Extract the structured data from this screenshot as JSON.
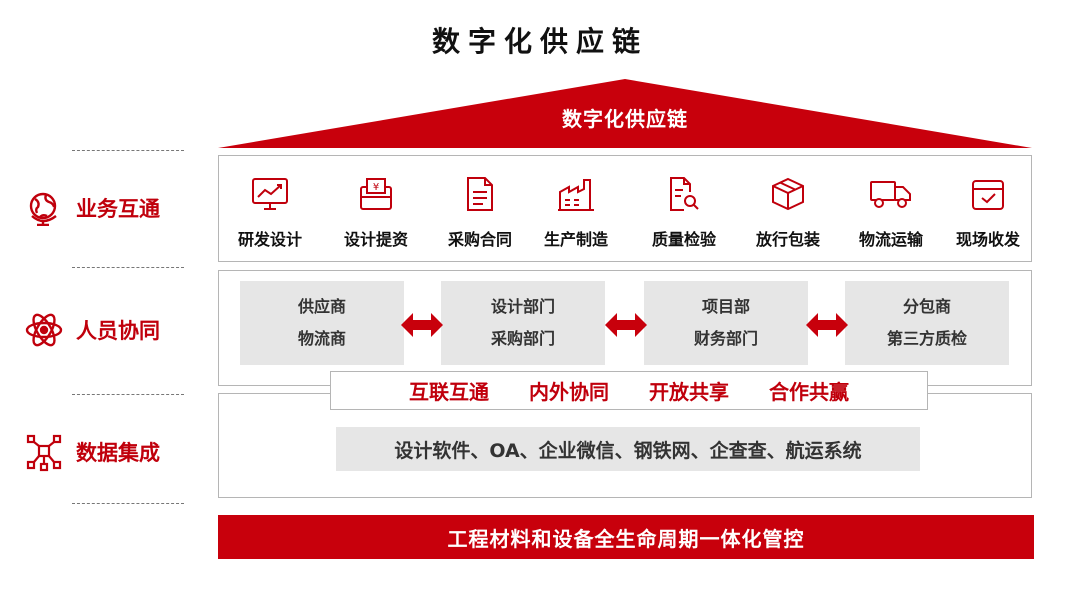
{
  "title": "数字化供应链",
  "roof_label": "数字化供应链",
  "colors": {
    "accent": "#c8000c",
    "panel_gray": "#e6e6e6",
    "border": "#b5b5b5"
  },
  "rows": [
    {
      "label": "业务互通",
      "icon": "globe-icon"
    },
    {
      "label": "人员协同",
      "icon": "atom-icon"
    },
    {
      "label": "数据集成",
      "icon": "network-icon"
    }
  ],
  "business_items": [
    {
      "label": "研发设计",
      "icon": "chart-monitor-icon"
    },
    {
      "label": "设计提资",
      "icon": "yuan-folder-icon"
    },
    {
      "label": "采购合同",
      "icon": "document-icon"
    },
    {
      "label": "生产制造",
      "icon": "factory-icon"
    },
    {
      "label": "质量检验",
      "icon": "search-document-icon"
    },
    {
      "label": "放行包装",
      "icon": "package-icon"
    },
    {
      "label": "物流运输",
      "icon": "truck-icon"
    },
    {
      "label": "现场收发",
      "icon": "inbox-check-icon"
    }
  ],
  "departments": [
    {
      "line1": "供应商",
      "line2": "物流商"
    },
    {
      "line1": "设计部门",
      "line2": "采购部门"
    },
    {
      "line1": "项目部",
      "line2": "财务部门"
    },
    {
      "line1": "分包商",
      "line2": "第三方质检"
    }
  ],
  "banner_items": [
    "互联互通",
    "内外协同",
    "开放共享",
    "合作共赢"
  ],
  "data_systems": "设计软件、OA、企业微信、钢铁网、企查查、航运系统",
  "footer": "工程材料和设备全生命周期一体化管控"
}
